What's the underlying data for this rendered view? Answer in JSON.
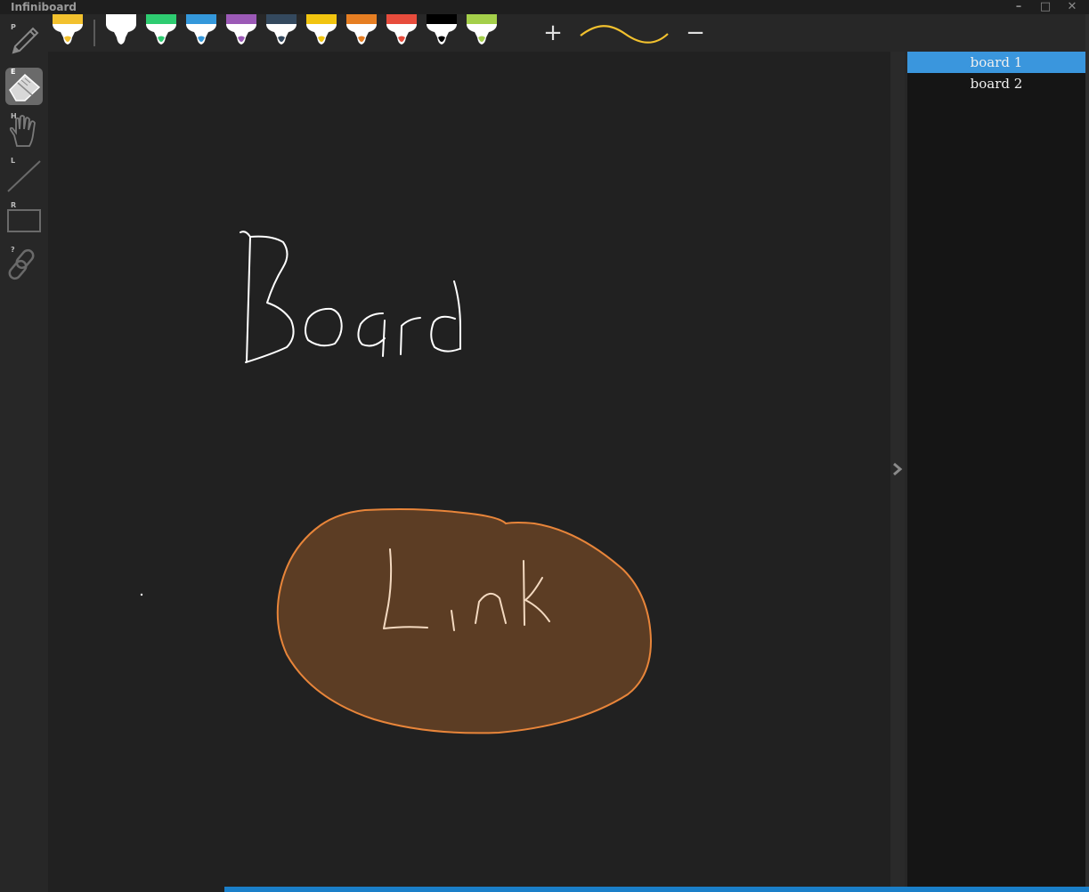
{
  "app": {
    "title": "Infiniboard"
  },
  "window_controls": {
    "minimize": "–",
    "maximize": "□",
    "close": "✕"
  },
  "tools": [
    {
      "name": "pen-tool",
      "key": "P",
      "icon": "pencil-icon",
      "active": false
    },
    {
      "name": "eraser-tool",
      "key": "E",
      "icon": "eraser-icon",
      "active": true
    },
    {
      "name": "hand-tool",
      "key": "H",
      "icon": "hand-icon",
      "active": false
    },
    {
      "name": "line-tool",
      "key": "L",
      "icon": "line-icon",
      "active": false
    },
    {
      "name": "rectangle-tool",
      "key": "R",
      "icon": "rectangle-icon",
      "active": false
    },
    {
      "name": "link-tool",
      "key": "?",
      "icon": "link-icon",
      "active": false
    }
  ],
  "markers": {
    "current": "#f2c12e",
    "palette": [
      "#ffffff",
      "#2ecc71",
      "#3498db",
      "#9b59b6",
      "#34495e",
      "#f1c40f",
      "#e67e22",
      "#e74c3c",
      "#000000",
      "#a4cf4a"
    ]
  },
  "stroke_size": {
    "increase": "+",
    "decrease": "−",
    "preview_color": "#f2c12e"
  },
  "canvas": {
    "background": "#212121",
    "link_fill": "#5c3d24",
    "link_stroke": "#e8853a",
    "link_text_color": "#f3d9c0",
    "ink_color": "#ffffff"
  },
  "board_list": {
    "items": [
      {
        "label": "board 1",
        "selected": true
      },
      {
        "label": "board 2",
        "selected": false
      }
    ]
  },
  "icons": {
    "expand": "chevron-right-icon"
  }
}
